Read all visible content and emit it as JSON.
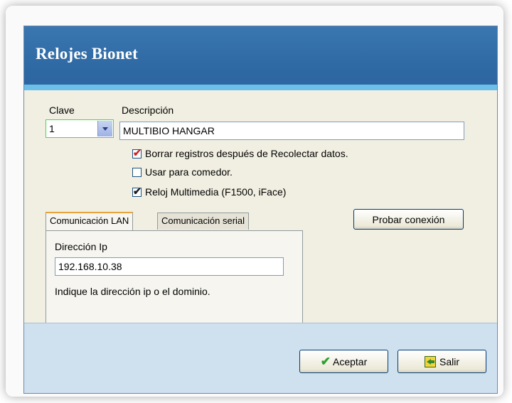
{
  "window": {
    "title": "Relojes Bionet"
  },
  "form": {
    "clave_label": "Clave",
    "clave_value": "1",
    "descripcion_label": "Descripción",
    "descripcion_value": "MULTIBIO HANGAR",
    "checkboxes": [
      {
        "label": "Borrar registros después de Recolectar datos.",
        "checked": true
      },
      {
        "label": "Usar para comedor.",
        "checked": false
      },
      {
        "label": "Reloj Multimedia  (F1500, iFace)",
        "checked": true
      }
    ]
  },
  "tabs": [
    {
      "label": "Comunicación LAN",
      "active": true
    },
    {
      "label": "Comunicación serial",
      "active": false
    }
  ],
  "lan": {
    "ip_label": "Dirección Ip",
    "ip_value": "192.168.10.38",
    "hint": "Indique la dirección ip o el dominio."
  },
  "buttons": {
    "test": "Probar conexión",
    "accept": "Aceptar",
    "exit": "Salir"
  },
  "colors": {
    "title_bar": "#2f6aa4",
    "title_stripe": "#6bbfe8",
    "footer": "#cfe0ef"
  },
  "icons": {
    "accept": "checkmark-icon",
    "exit": "exit-door-icon",
    "dropdown": "chevron-down-icon"
  }
}
